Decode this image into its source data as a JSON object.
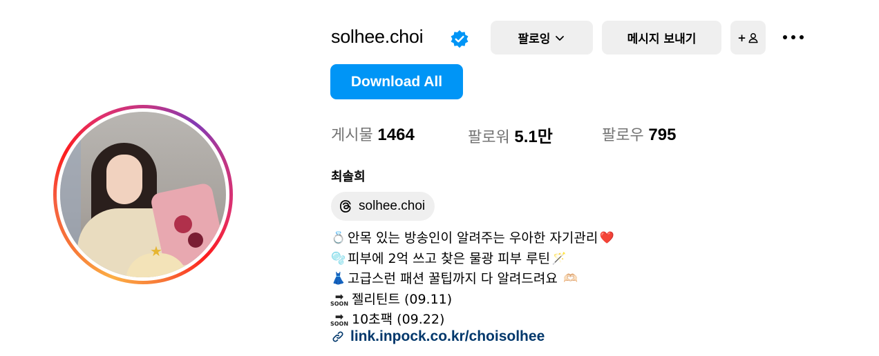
{
  "profile": {
    "username": "solhee.choi",
    "full_name": "최솔희",
    "verified": true
  },
  "actions": {
    "follow_label": "팔로잉",
    "message_label": "메시지 보내기",
    "add_user_symbol": "+",
    "download_label": "Download All"
  },
  "stats": {
    "posts_label": "게시물",
    "posts_value": "1464",
    "followers_label": "팔로워",
    "followers_value": "5.1만",
    "following_label": "팔로우",
    "following_value": "795"
  },
  "threads": {
    "handle": "solhee.choi"
  },
  "bio": {
    "line1": "안목 있는 방송인이 알려주는 우아한 자기관리",
    "line1_emoji_start": "💍",
    "line1_emoji_end": "❤️",
    "line2": "피부에 2억 쓰고 찾은 물광 피부 루틴",
    "line2_emoji_start": "🫧",
    "line2_emoji_end": "🪄",
    "line3": "고급스런 패션 꿀팁까지 다 알려드려요",
    "line3_emoji_start": "👗",
    "line3_emoji_end": "🫶🏻",
    "soon_text": "SOON",
    "line4": "젤리틴트 (09.11)",
    "line5": "10초팩 (09.22)"
  },
  "link": {
    "text": "link.inpock.co.kr/choisolhee"
  },
  "colors": {
    "accent": "#0095f6",
    "button_gray": "#efefef",
    "link": "#00376b",
    "verified": "#0095f6"
  }
}
